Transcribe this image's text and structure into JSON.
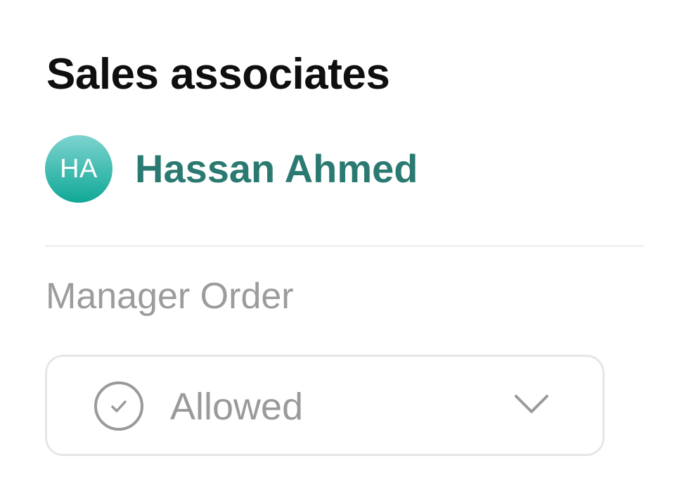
{
  "section": {
    "title": "Sales associates"
  },
  "associate": {
    "initials": "HA",
    "name": "Hassan Ahmed",
    "avatar_gradient_top": "#7dd3cf",
    "avatar_gradient_bottom": "#10a896",
    "name_color": "#2b7a71"
  },
  "manager_order": {
    "label": "Manager Order",
    "selected_value": "Allowed",
    "icon": "check-circle-icon",
    "dropdown_icon": "chevron-down-icon"
  }
}
